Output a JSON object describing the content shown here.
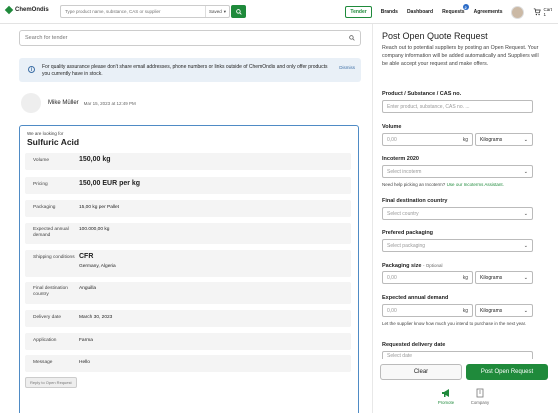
{
  "header": {
    "logo_text": "ChemOndis",
    "search_placeholder": "Type product name, substance, CAS or supplier",
    "saved_label": "Saved",
    "nav": {
      "tender": "Tender",
      "brands": "Brands",
      "dashboard": "Dashboard",
      "requests": "Requests",
      "requests_badge": "2",
      "agreements": "Agreements",
      "cart": "Cart",
      "cart_count": "1"
    }
  },
  "left": {
    "search_placeholder": "Search for tender",
    "info_text": "For quality assurance please don't share email addresses, phone numbers or links outside of ChemOndis and only offer products you currently have in stock.",
    "dismiss": "Dismiss",
    "author": "Mike Müller",
    "date": "Mar 15, 2023 at 12:49 PM",
    "card": {
      "looking_for": "We are looking for",
      "product": "Sulfuric Acid",
      "rows": [
        {
          "key": "Volume",
          "value": "150,00 kg"
        },
        {
          "key": "Pricing",
          "value": "150,00 EUR per kg"
        },
        {
          "key": "Packaging",
          "value": "15,00 kg per Pallet"
        },
        {
          "key": "Expected annual demand",
          "value": "100.000,00 kg"
        },
        {
          "key": "Shipping conditions",
          "value": "CFR",
          "value2": "Germany, Algeria"
        },
        {
          "key": "Final destination country",
          "value": "Anguilla"
        },
        {
          "key": "Delivery date",
          "value": "March 30, 2023"
        },
        {
          "key": "Application",
          "value": "Farma"
        },
        {
          "key": "Message",
          "value": "Hello"
        }
      ],
      "reply_button": "Reply to Open Request"
    }
  },
  "right": {
    "title": "Post Open Quote Request",
    "description": "Reach out to potential suppliers by posting an Open Request. Your company information will be added automatically and Suppliers will be able accept your request and make offers.",
    "product_label": "Product / Substance / CAS no.",
    "product_placeholder": "Enter product, substance, CAS no. ...",
    "volume_label": "Volume",
    "volume_placeholder": "0,00",
    "volume_unit": "kg",
    "volume_select": "Kilograms",
    "incoterm_label": "Incoterm 2020",
    "incoterm_placeholder": "Select incoterm",
    "incoterm_help": "Need help picking an Incoterm?",
    "incoterm_help_link": "Use our Incoterms Assistant.",
    "destination_label": "Final destination country",
    "destination_placeholder": "Select country",
    "packaging_label": "Prefered packaging",
    "packaging_placeholder": "Select packaging",
    "packaging_size_label": "Packaging size",
    "packaging_size_optional": "- Optional",
    "packaging_size_placeholder": "0,00",
    "packaging_size_unit": "kg",
    "packaging_size_select": "Kilograms",
    "annual_label": "Expected annual demand",
    "annual_placeholder": "0,00",
    "annual_unit": "kg",
    "annual_select": "Kilograms",
    "annual_help": "Let the supplier know how much you intend to purchase in the next year.",
    "delivery_label": "Requested delivery date",
    "delivery_placeholder": "Select date",
    "clear_button": "Clear",
    "post_button": "Post Open Request",
    "tabs": [
      {
        "label": "Promote"
      },
      {
        "label": "Company"
      }
    ]
  },
  "colors": {
    "brand_green": "#1f8a3b",
    "info_bg": "#e9f0f7",
    "card_border": "#4f8bc5"
  }
}
